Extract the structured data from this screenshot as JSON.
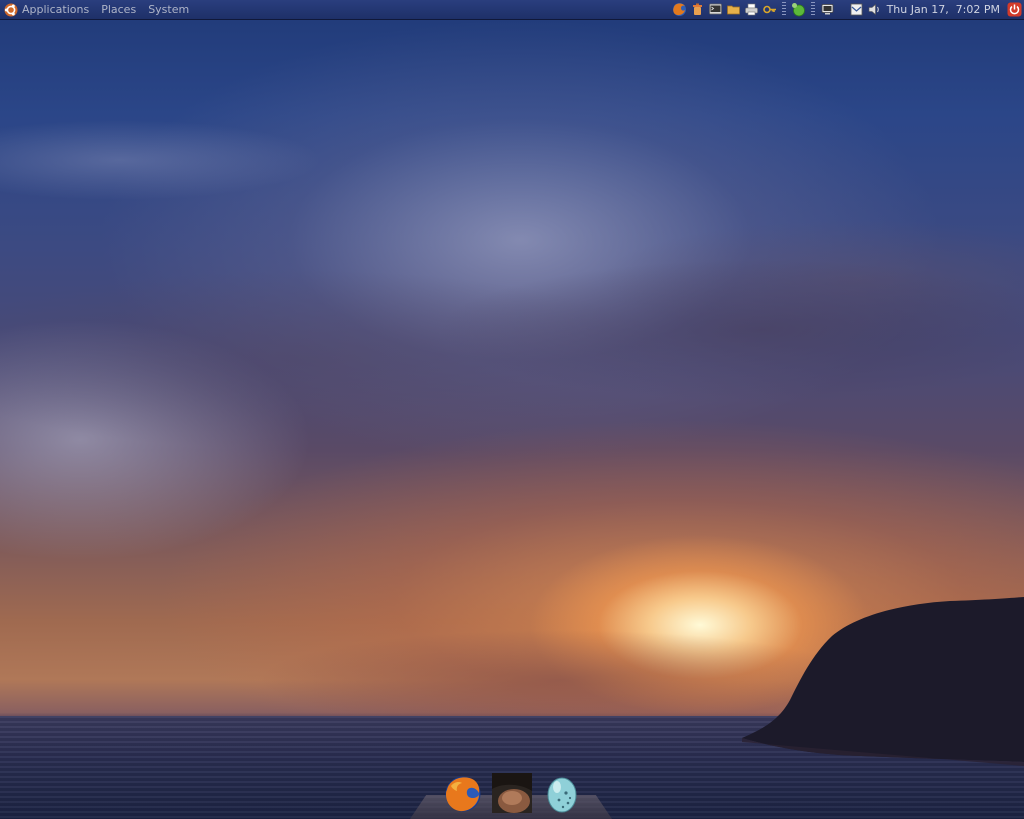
{
  "top_panel": {
    "menus": [
      {
        "label": "Applications"
      },
      {
        "label": "Places"
      },
      {
        "label": "System"
      }
    ],
    "launchers": [
      "firefox-icon",
      "trash-icon",
      "terminal-icon",
      "folder-icon",
      "printer-icon",
      "keys-icon"
    ],
    "notification_area": [
      "network-status-icon",
      "display-icon",
      "mail-icon",
      "volume-icon"
    ],
    "clock": "Thu Jan 17,  7:02 PM",
    "shutdown_icon": "power-icon"
  },
  "dock": {
    "items": [
      "firefox-icon",
      "user-photo",
      "egg-icon"
    ]
  },
  "colors": {
    "panel": "#1e3068",
    "panel_text": "#aeb4c8",
    "shutdown_red": "#d23a2a"
  }
}
